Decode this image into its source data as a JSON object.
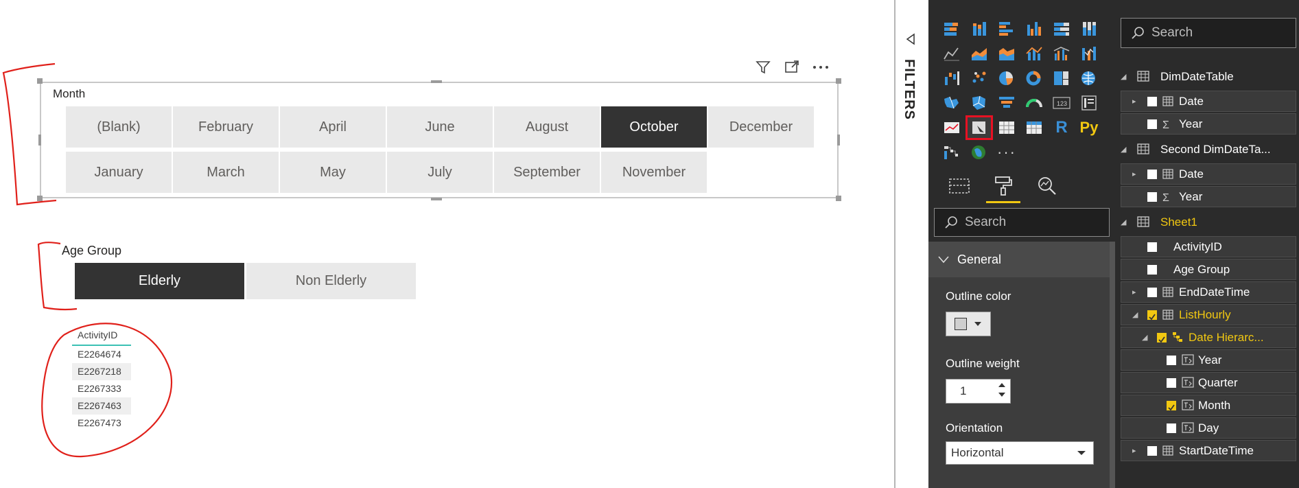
{
  "month_slicer": {
    "title": "Month",
    "items": [
      "(Blank)",
      "February",
      "April",
      "June",
      "August",
      "October",
      "December",
      "January",
      "March",
      "May",
      "July",
      "September",
      "November"
    ],
    "selected": "October"
  },
  "age_slicer": {
    "title": "Age Group",
    "items": [
      "Elderly",
      "Non Elderly"
    ],
    "selected": "Elderly"
  },
  "activity_table": {
    "header": "ActivityID",
    "rows": [
      "E2264674",
      "E2267218",
      "E2267333",
      "E2267463",
      "E2267473"
    ]
  },
  "filters_pane": {
    "label": "FILTERS"
  },
  "visualizations": {
    "icons": [
      "stacked-bar",
      "stacked-column",
      "clustered-bar",
      "clustered-column",
      "100-stacked-bar",
      "100-stacked-column",
      "line",
      "area",
      "stacked-area",
      "line-and-stacked-column",
      "line-and-clustered-column",
      "ribbon",
      "waterfall",
      "scatter",
      "pie",
      "donut",
      "treemap",
      "map",
      "filled-map",
      "shape-map",
      "funnel",
      "gauge",
      "card",
      "multi-row-card",
      "kpi",
      "slicer",
      "table",
      "matrix",
      "r-visual",
      "python-visual",
      "decomposition-tree",
      "globe",
      "more"
    ],
    "selected": "slicer",
    "r_label": "R",
    "py_label": "Py",
    "more_label": "···",
    "tabs": [
      "fields-tab",
      "format-tab",
      "analytics-tab"
    ],
    "active_tab": "format-tab",
    "search_placeholder": "Search"
  },
  "format": {
    "section": "General",
    "outline_color_label": "Outline color",
    "outline_weight_label": "Outline weight",
    "outline_weight_value": "1",
    "orientation_label": "Orientation",
    "orientation_value": "Horizontal"
  },
  "fields": {
    "search_placeholder": "Search",
    "items": [
      {
        "label": "DimDateTable",
        "kind": "table",
        "level": 0
      },
      {
        "label": "Date",
        "kind": "date",
        "level": 1,
        "expandable": true,
        "checked": false
      },
      {
        "label": "Year",
        "kind": "sigma",
        "level": 1,
        "checked": false
      },
      {
        "label": "Second DimDateTa...",
        "kind": "table",
        "level": 0
      },
      {
        "label": "Date",
        "kind": "date",
        "level": 1,
        "expandable": true,
        "checked": false
      },
      {
        "label": "Year",
        "kind": "sigma",
        "level": 1,
        "checked": false
      },
      {
        "label": "Sheet1",
        "kind": "table",
        "level": 0,
        "highlight": true
      },
      {
        "label": "ActivityID",
        "kind": "text",
        "level": 1,
        "checked": false
      },
      {
        "label": "Age Group",
        "kind": "text",
        "level": 1,
        "checked": false
      },
      {
        "label": "EndDateTime",
        "kind": "date",
        "level": 1,
        "expandable": true,
        "checked": false
      },
      {
        "label": "ListHourly",
        "kind": "date",
        "level": 1,
        "expandable": true,
        "checked": true,
        "highlight": true
      },
      {
        "label": "Date Hierarc...",
        "kind": "hierarchy",
        "level": 2,
        "expandable": true,
        "checked": true,
        "highlight": true
      },
      {
        "label": "Year",
        "kind": "level",
        "level": 3,
        "checked": false
      },
      {
        "label": "Quarter",
        "kind": "level",
        "level": 3,
        "checked": false
      },
      {
        "label": "Month",
        "kind": "level",
        "level": 3,
        "checked": true
      },
      {
        "label": "Day",
        "kind": "level",
        "level": 3,
        "checked": false
      },
      {
        "label": "StartDateTime",
        "kind": "date",
        "level": 1,
        "expandable": true,
        "checked": false
      }
    ]
  }
}
